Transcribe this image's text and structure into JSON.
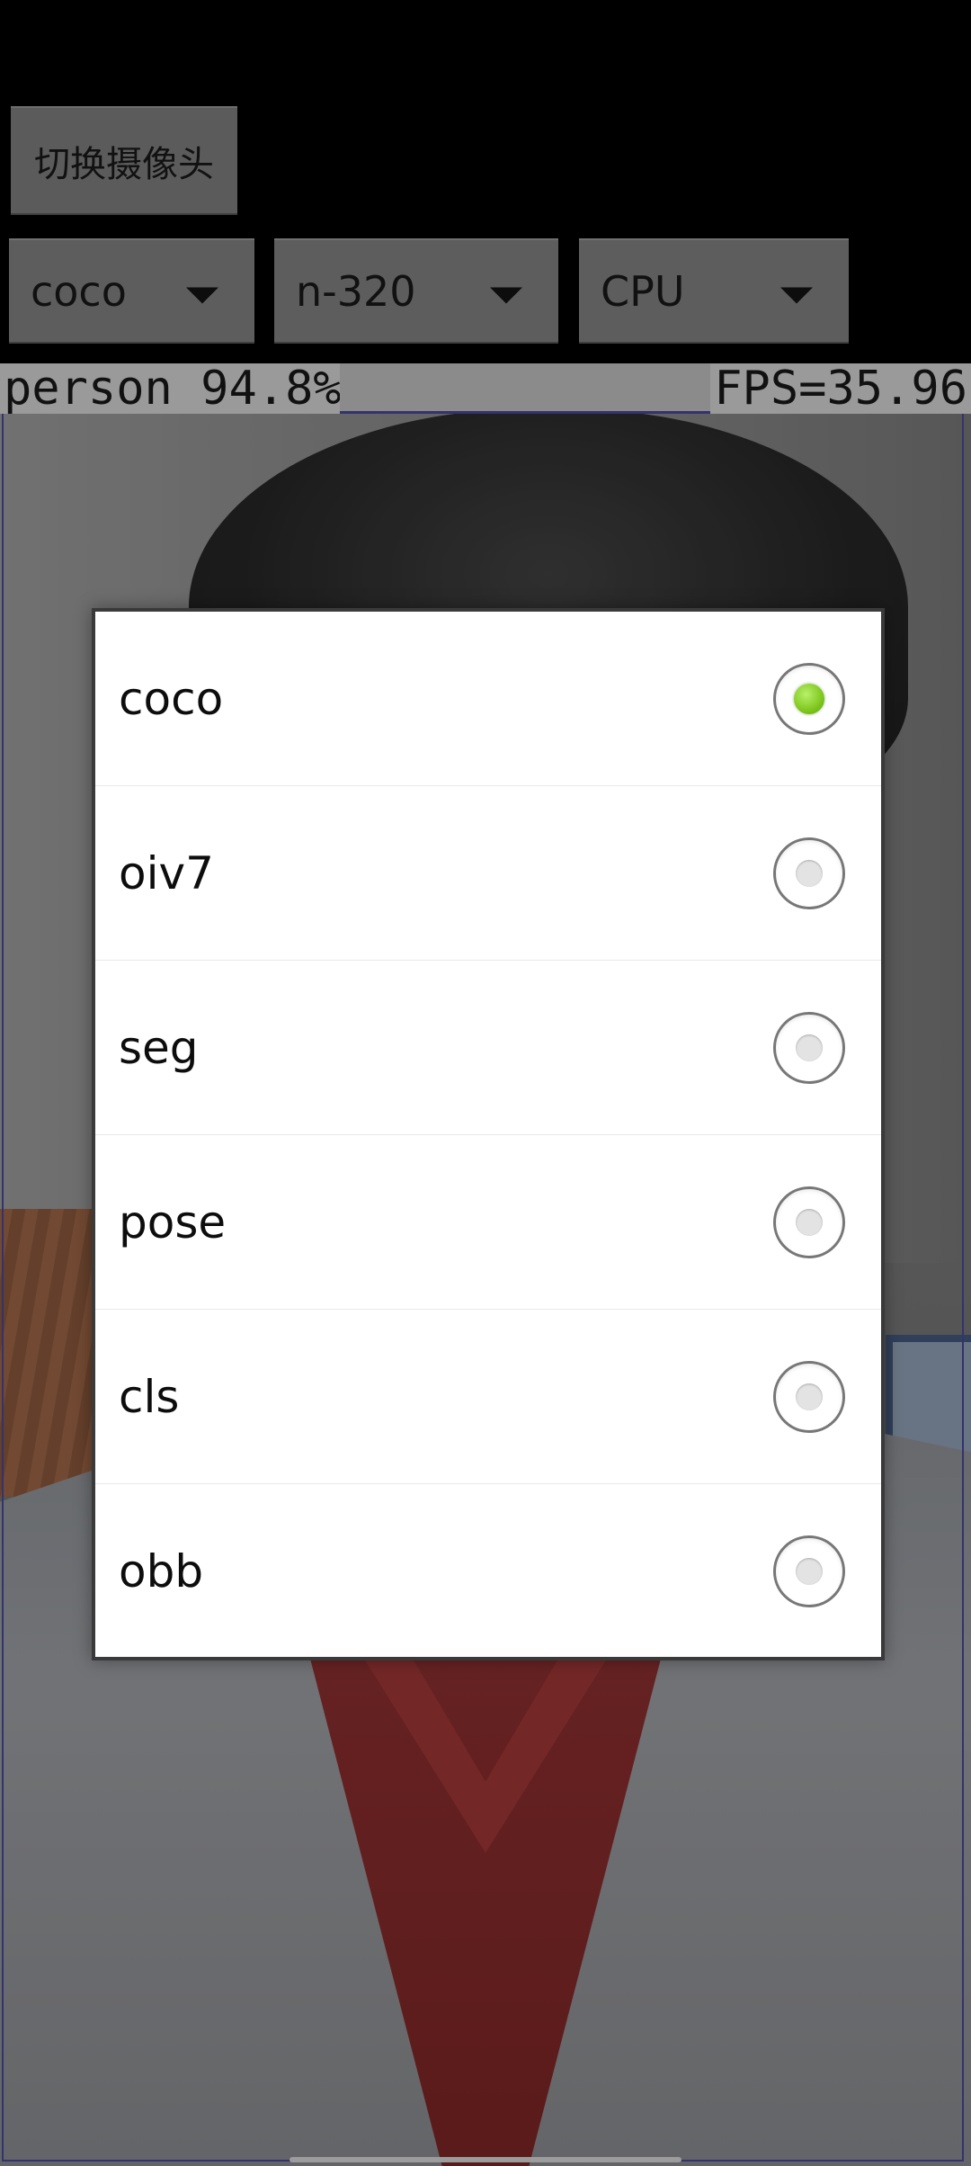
{
  "toolbar": {
    "switch_camera_label": "切换摄像头",
    "model_spinner": {
      "selected": "coco"
    },
    "size_spinner": {
      "selected": "n-320"
    },
    "device_spinner": {
      "selected": "CPU"
    }
  },
  "overlay": {
    "detection_label": "person 94.8%",
    "fps_label": "FPS=35.96"
  },
  "dialog": {
    "options": [
      {
        "label": "coco",
        "checked": true
      },
      {
        "label": "oiv7",
        "checked": false
      },
      {
        "label": "seg",
        "checked": false
      },
      {
        "label": "pose",
        "checked": false
      },
      {
        "label": "cls",
        "checked": false
      },
      {
        "label": "obb",
        "checked": false
      }
    ]
  },
  "colors": {
    "radio_selected": "#7fc71e",
    "detection_box": "#33336e",
    "button_bg": "#5b5b5b"
  },
  "icons": {
    "spinner_caret": "caret-down-icon"
  }
}
